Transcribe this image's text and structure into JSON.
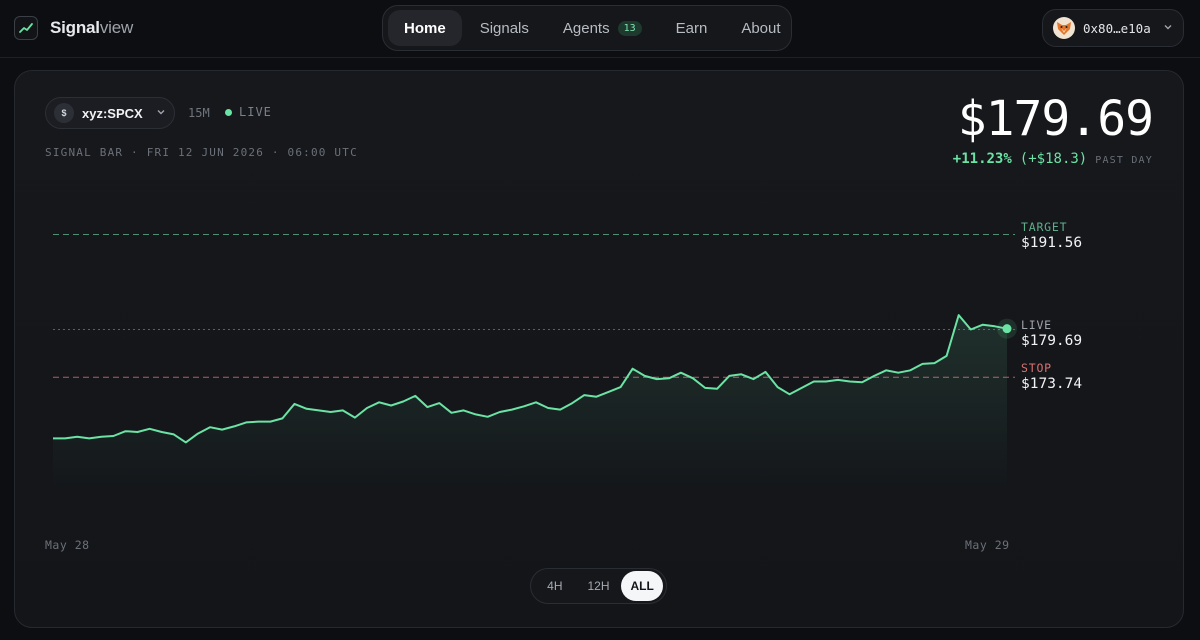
{
  "brand": {
    "name_bold": "Signal",
    "name_light": "view"
  },
  "nav": {
    "items": [
      {
        "label": "Home",
        "active": true
      },
      {
        "label": "Signals"
      },
      {
        "label": "Agents",
        "badge": "13"
      },
      {
        "label": "Earn"
      },
      {
        "label": "About"
      }
    ]
  },
  "wallet": {
    "address": "0x80…e10a",
    "icon": "fox-icon"
  },
  "asset": {
    "icon_letter": "$",
    "symbol": "xyz:SPCX",
    "interval": "15M",
    "live_label": "LIVE",
    "bar_info": "SIGNAL BAR · FRI 12 JUN 2026 · 06:00 UTC"
  },
  "quote": {
    "price": "$179.69",
    "change_pct": "+11.23%",
    "change_abs": "(+$18.3)",
    "period": "PAST DAY"
  },
  "levels": {
    "target": {
      "label": "TARGET",
      "value": "$191.56"
    },
    "live": {
      "label": "LIVE",
      "value": "$179.69"
    },
    "stop": {
      "label": "STOP",
      "value": "$173.74"
    }
  },
  "range": {
    "options": [
      "4H",
      "12H",
      "ALL"
    ],
    "selected": "ALL"
  },
  "colors": {
    "accent": "#6be3a4",
    "stop": "#d97070",
    "target": "#5fae8a"
  },
  "chart_data": {
    "type": "line",
    "x_labels": [
      "May 28",
      "May 29"
    ],
    "target": 191.56,
    "live": 179.69,
    "stop": 173.74,
    "values": [
      166.1,
      166.1,
      166.3,
      166.1,
      166.3,
      166.4,
      167.0,
      166.9,
      167.3,
      166.9,
      166.6,
      165.6,
      166.7,
      167.5,
      167.2,
      167.6,
      168.1,
      168.2,
      168.2,
      168.6,
      170.4,
      169.8,
      169.6,
      169.4,
      169.6,
      168.7,
      169.9,
      170.6,
      170.2,
      170.7,
      171.4,
      170.0,
      170.5,
      169.3,
      169.6,
      169.1,
      168.8,
      169.4,
      169.7,
      170.1,
      170.6,
      169.9,
      169.7,
      170.5,
      171.5,
      171.3,
      171.9,
      172.5,
      174.8,
      173.9,
      173.5,
      173.6,
      174.3,
      173.6,
      172.4,
      172.3,
      173.9,
      174.1,
      173.5,
      174.4,
      172.5,
      171.6,
      172.4,
      173.2,
      173.2,
      173.4,
      173.2,
      173.1,
      173.9,
      174.6,
      174.3,
      174.6,
      175.4,
      175.5,
      176.4,
      181.5,
      179.7,
      180.3,
      180.1,
      179.8
    ]
  }
}
